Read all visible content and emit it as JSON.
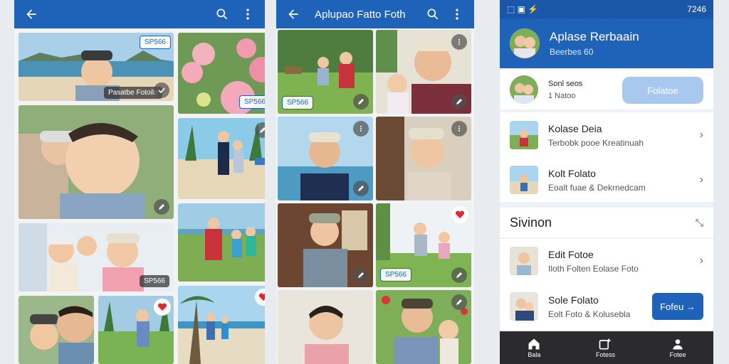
{
  "screen1": {
    "tiles": [
      {
        "badge": "SP566"
      },
      {
        "badge": "Pasatbe Fotoiln"
      },
      {
        "badge": "SP566"
      },
      {
        "badge": "SP566"
      },
      {
        "badge": "SP566"
      }
    ]
  },
  "screen2": {
    "title": "Aplupao Fatto Foth",
    "badges": [
      "SP566",
      "SP566"
    ]
  },
  "screen3": {
    "status_time": "7246",
    "header_title": "Aplase Rerbaain",
    "header_subtitle": "Beerbes 60",
    "first_row": {
      "title": "Sonl seos",
      "sub": "1 Natoo",
      "button": "Folatoe"
    },
    "rows": [
      {
        "title": "Kolase Deia",
        "sub": "Terbobk pooe Kreatinuah"
      },
      {
        "title": "Kolt Folato",
        "sub": "Eoalt fuae & Dekrnedcam"
      }
    ],
    "section_title": "Sivinon",
    "section_rows": [
      {
        "title": "Edit Fotoe",
        "sub": "Iloth Folten Eolase Foto"
      },
      {
        "title": "Sole Folato",
        "sub": "Eolt Foto & Kolusebla",
        "button": "Fofeu →"
      }
    ],
    "nav": [
      "Bala",
      "Fotess",
      "Fotee"
    ]
  },
  "colors": {
    "accent": "#1f63b8",
    "heart": "#e3262f"
  },
  "icons": [
    "back-arrow-icon",
    "search-icon",
    "more-vert-icon",
    "heart-icon",
    "edit-icon",
    "chevron-right-icon",
    "home-icon",
    "photo-add-icon",
    "person-icon"
  ]
}
